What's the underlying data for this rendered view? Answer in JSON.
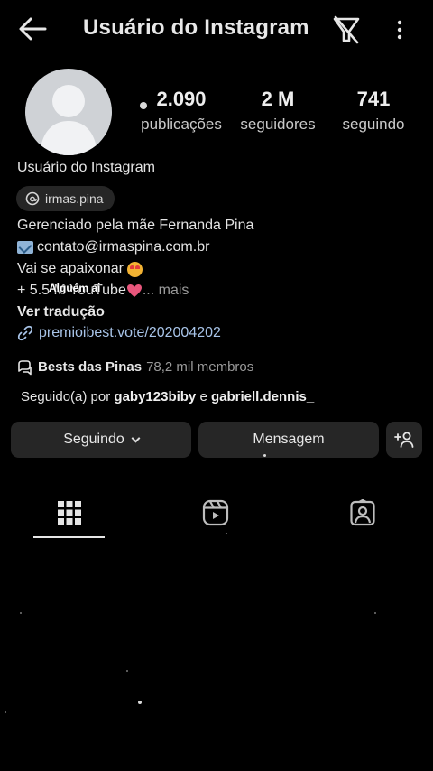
{
  "header": {
    "title": "Usuário do Instagram"
  },
  "stats": [
    {
      "value": "2.090",
      "label": "publicações"
    },
    {
      "value": "2 M",
      "label": "seguidores"
    },
    {
      "value": "741",
      "label": "seguindo"
    }
  ],
  "profile": {
    "name": "Usuário do Instagram",
    "threads_handle": "irmas.pina",
    "bio_line1": "Gerenciado pela mãe Fernanda Pina",
    "bio_email": "contato@irmaspina.com.br",
    "bio_line3": "Vai se apaixonar",
    "bio_line4_prefix": "+ 5.5 M YouTube",
    "bio_more": "... mais",
    "overlay_caption": "Alguém ai",
    "translate_label": "Ver tradução",
    "link": "premioibest.vote/202004202"
  },
  "channel": {
    "name": "Bests das Pinas",
    "members": "78,2 mil membros"
  },
  "followed_by": {
    "prefix": "Seguido(a) por ",
    "user1": "gaby123biby",
    "joiner": " e ",
    "user2": "gabriell.dennis_"
  },
  "actions": {
    "following_label": "Seguindo",
    "message_label": "Mensagem"
  },
  "tabs": [
    "grid-icon",
    "reels-icon",
    "tagged-icon"
  ],
  "colors": {
    "background": "#000000",
    "button_bg": "#262626",
    "link": "#a8c4e8",
    "muted": "#9a9a9a"
  }
}
